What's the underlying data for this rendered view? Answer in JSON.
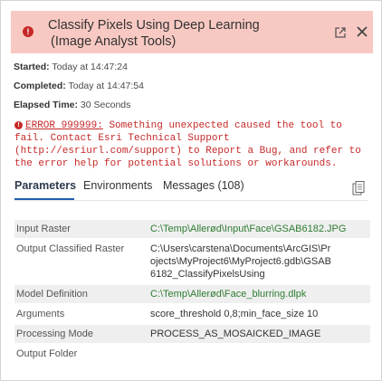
{
  "header": {
    "title_line1": "Classify Pixels Using Deep Learning",
    "title_line2": "(Image Analyst Tools)"
  },
  "meta": {
    "started_label": "Started:",
    "started_value": "Today at 14:47:24",
    "completed_label": "Completed:",
    "completed_value": "Today at 14:47:54",
    "elapsed_label": "Elapsed Time:",
    "elapsed_value": "30 Seconds"
  },
  "error": {
    "code": "ERROR 999999:",
    "message": "Something unexpected caused the tool to fail. Contact Esri Technical Support (http://esriurl.com/support) to Report a Bug, and refer to the error help for potential solutions or workarounds."
  },
  "tabs": [
    {
      "label": "Parameters",
      "active": true
    },
    {
      "label": "Environments",
      "active": false
    },
    {
      "label": "Messages (108)",
      "active": false
    }
  ],
  "parameters": [
    {
      "label": "Input Raster",
      "value": "C:\\Temp\\Allerød\\Input\\Face\\GSAB6182.JPG",
      "link": true
    },
    {
      "label": "Output Classified Raster",
      "value": "C:\\Users\\carstena\\Documents\\ArcGIS\\Projects\\MyProject6\\MyProject6.gdb\\GSAB6182_ClassifyPixelsUsing",
      "link": false
    },
    {
      "label": "Model Definition",
      "value": "C:\\Temp\\Allerød\\Face_blurring.dlpk",
      "link": true
    },
    {
      "label": "Arguments",
      "value": "score_threshold 0,8;min_face_size 10",
      "link": false
    },
    {
      "label": "Processing Mode",
      "value": "PROCESS_AS_MOSAICKED_IMAGE",
      "link": false
    },
    {
      "label": "Output Folder",
      "value": "",
      "link": false
    }
  ]
}
